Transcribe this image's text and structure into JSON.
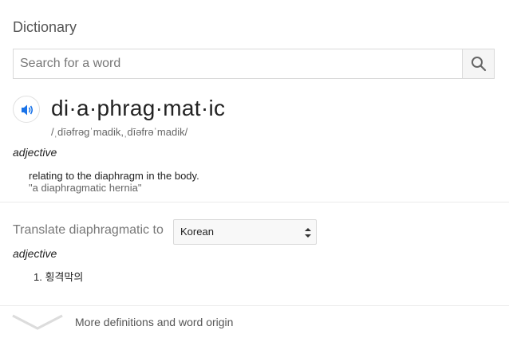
{
  "panel": {
    "title": "Dictionary"
  },
  "search": {
    "placeholder": "Search for a word"
  },
  "entry": {
    "headword": "di·a·phrag·mat·ic",
    "phonetic": "/ˌdīəfrəgˈmadik,ˌdīəfrəˈmadik/",
    "part_of_speech": "adjective",
    "definition": "relating to the diaphragm in the body.",
    "example": "\"a diaphragmatic hernia\""
  },
  "translate": {
    "label": "Translate diaphragmatic to",
    "language": "Korean",
    "part_of_speech": "adjective",
    "items": [
      "1. 횡격막의"
    ]
  },
  "footer": {
    "more_label": "More definitions and word origin"
  },
  "icons": {
    "search": "search-icon",
    "speaker": "speaker-icon",
    "select_arrows": "up-down-arrows-icon",
    "expand": "chevron-down-icon"
  },
  "colors": {
    "speaker_blue": "#1a73e8",
    "muted_text": "#777777"
  }
}
